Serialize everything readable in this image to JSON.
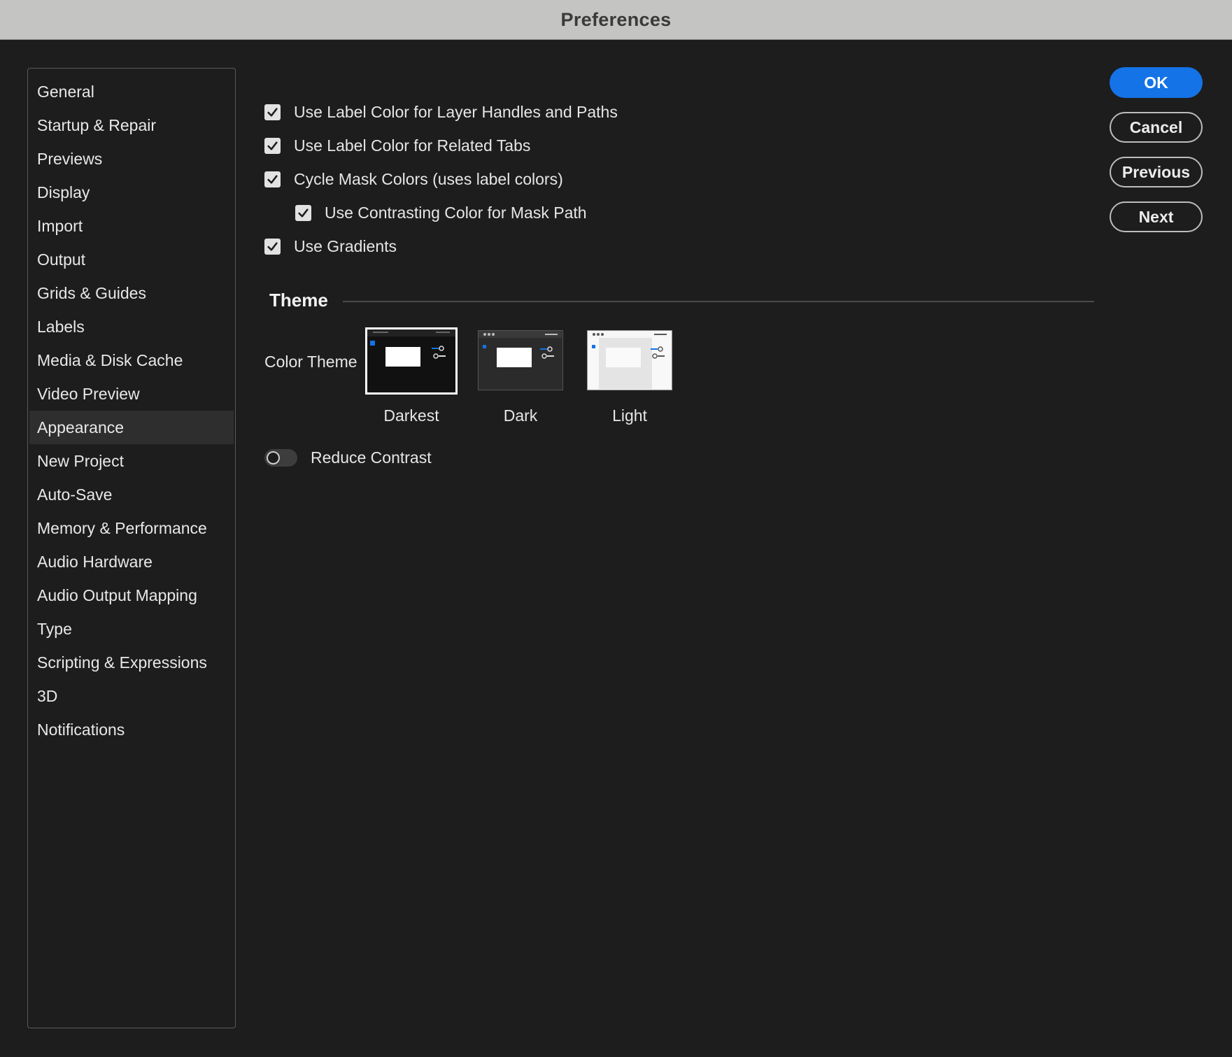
{
  "window": {
    "title": "Preferences"
  },
  "sidebar": {
    "items": [
      {
        "label": "General"
      },
      {
        "label": "Startup & Repair"
      },
      {
        "label": "Previews"
      },
      {
        "label": "Display"
      },
      {
        "label": "Import"
      },
      {
        "label": "Output"
      },
      {
        "label": "Grids & Guides"
      },
      {
        "label": "Labels"
      },
      {
        "label": "Media & Disk Cache"
      },
      {
        "label": "Video Preview"
      },
      {
        "label": "Appearance",
        "selected": true
      },
      {
        "label": "New Project"
      },
      {
        "label": "Auto-Save"
      },
      {
        "label": "Memory & Performance"
      },
      {
        "label": "Audio Hardware"
      },
      {
        "label": "Audio Output Mapping"
      },
      {
        "label": "Type"
      },
      {
        "label": "Scripting & Expressions"
      },
      {
        "label": "3D"
      },
      {
        "label": "Notifications"
      }
    ]
  },
  "options": {
    "label_color_handles": {
      "label": "Use Label Color for Layer Handles and Paths",
      "checked": true
    },
    "label_color_tabs": {
      "label": "Use Label Color for Related Tabs",
      "checked": true
    },
    "cycle_mask_colors": {
      "label": "Cycle Mask Colors (uses label colors)",
      "checked": true
    },
    "contrasting_mask_path": {
      "label": "Use Contrasting Color for Mask Path",
      "checked": true
    },
    "use_gradients": {
      "label": "Use Gradients",
      "checked": true
    }
  },
  "theme": {
    "heading": "Theme",
    "color_theme_label": "Color Theme",
    "options": [
      {
        "name": "Darkest",
        "selected": true
      },
      {
        "name": "Dark",
        "selected": false
      },
      {
        "name": "Light",
        "selected": false
      }
    ],
    "reduce_contrast": {
      "label": "Reduce Contrast",
      "on": false
    }
  },
  "buttons": {
    "ok": "OK",
    "cancel": "Cancel",
    "previous": "Previous",
    "next": "Next"
  },
  "colors": {
    "accent": "#1473e6",
    "background": "#1d1d1d",
    "titlebar": "#c4c4c2"
  }
}
